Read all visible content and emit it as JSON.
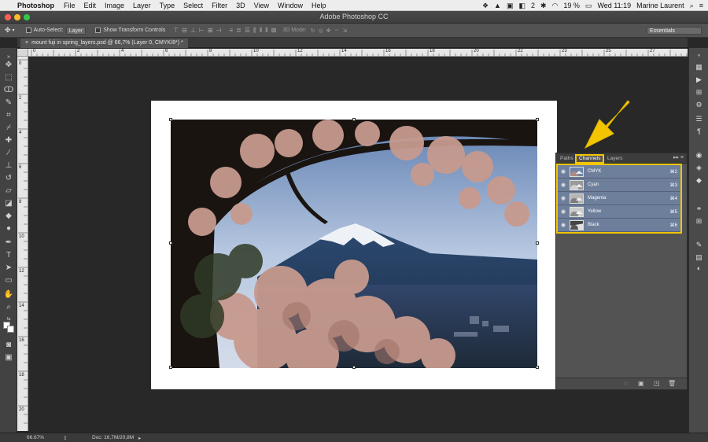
{
  "menubar": {
    "app_name": "Photoshop",
    "items": [
      "File",
      "Edit",
      "Image",
      "Layer",
      "Type",
      "Select",
      "Filter",
      "3D",
      "View",
      "Window",
      "Help"
    ],
    "status_badge": "2",
    "battery": "19 %",
    "clock": "Wed 11:19",
    "user": "Marine Laurent",
    "icons": [
      "apple-icon",
      "dropbox-icon",
      "drive-icon",
      "wifi-icon",
      "battery-icon",
      "search-icon",
      "list-icon"
    ]
  },
  "window": {
    "title": "Adobe Photoshop CC"
  },
  "options_bar": {
    "auto_select_label": "Auto-Select:",
    "auto_select_value": "Layer",
    "transform_label": "Show Transform Controls",
    "mode_label": "3D Mode:",
    "workspace": "Essentials"
  },
  "document": {
    "tab_label": "mount fuji in spring_layers.psd @ 66,7% (Layer 0, CMYK/8*) *"
  },
  "rulers": {
    "top": [
      "0",
      "2",
      "4",
      "6",
      "8",
      "10",
      "12",
      "14",
      "16",
      "18",
      "20",
      "22",
      "23",
      "25",
      "27"
    ],
    "left": [
      "0",
      "2",
      "4",
      "6",
      "8",
      "10",
      "12",
      "14",
      "16",
      "18",
      "20"
    ]
  },
  "panel": {
    "tabs": [
      "Paths",
      "Channels",
      "Layers"
    ],
    "active_tab": "Channels",
    "channels": [
      {
        "name": "CMYK",
        "key": "⌘2"
      },
      {
        "name": "Cyan",
        "key": "⌘3"
      },
      {
        "name": "Magenta",
        "key": "⌘4"
      },
      {
        "name": "Yellow",
        "key": "⌘5"
      },
      {
        "name": "Black",
        "key": "⌘6"
      }
    ],
    "highlight_color": "#f2c500",
    "selected_row_color": "#6e7f9b"
  },
  "status": {
    "zoom": "66.67%",
    "doc_size": "Doc: 16,7M/20,8M"
  },
  "colors": {
    "annotation_arrow": "#f2c500",
    "chrome_dark": "#282828"
  }
}
